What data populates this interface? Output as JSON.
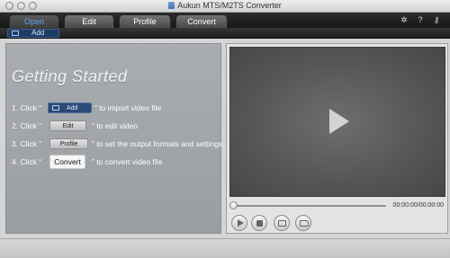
{
  "window": {
    "title": "Aukun MTS/M2TS Converter"
  },
  "tabs": [
    {
      "label": "Open",
      "active": true
    },
    {
      "label": "Edit",
      "active": false
    },
    {
      "label": "Profile",
      "active": false
    },
    {
      "label": "Convert",
      "active": false
    }
  ],
  "subbar": {
    "add_label": "Add"
  },
  "guide": {
    "title": "Getting Started",
    "steps": [
      {
        "lead": "1. Click “",
        "button": "Add",
        "tail": "” to import video file"
      },
      {
        "lead": "2. Click “",
        "button": "Edit",
        "tail": "” to edit video"
      },
      {
        "lead": "3. Click “",
        "button": "Profile",
        "tail": "” to set the output formats and settings"
      },
      {
        "lead": "4. Click “",
        "button": "Convert",
        "tail": "” to convert video file"
      }
    ]
  },
  "player": {
    "timecode": "00:00:00/00:00:00",
    "progress": 0
  },
  "icons": {
    "settings": "gear-icon",
    "help": "help-icon",
    "register": "key-icon",
    "play": "play-icon",
    "stop": "stop-icon",
    "snapshot": "snapshot-icon",
    "folder": "folder-icon"
  },
  "colors": {
    "active_tab_text": "#5fa9ea",
    "add_button": "#2b4a78",
    "toolbar": "#1f1f1f"
  }
}
